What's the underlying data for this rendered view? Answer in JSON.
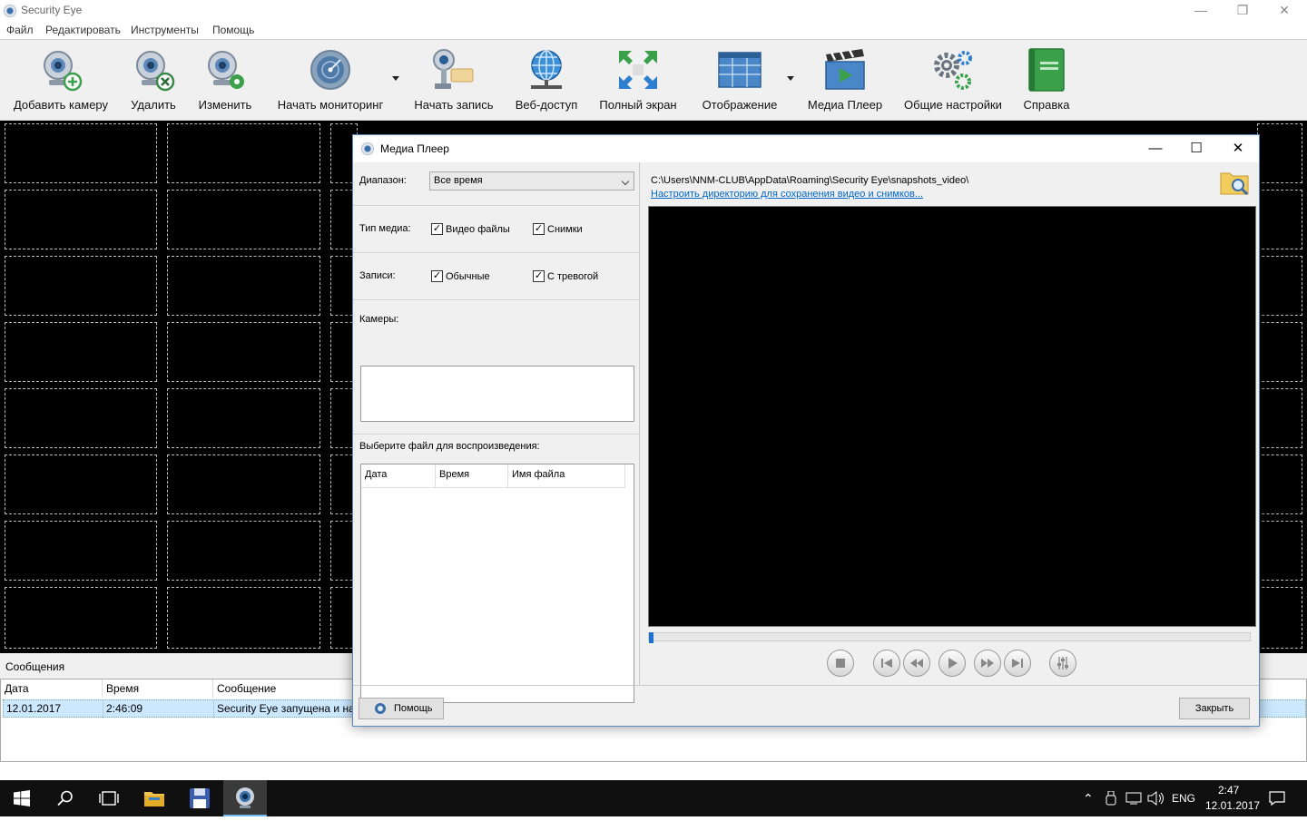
{
  "app": {
    "title": "Security Eye",
    "controls": {
      "minimize": "—",
      "restore": "❐",
      "close": "✕"
    }
  },
  "menu": [
    "Файл",
    "Редактировать",
    "Инструменты",
    "Помощь"
  ],
  "toolbar": {
    "items": [
      {
        "label": "Добавить камеру",
        "icon": "camera-add-icon"
      },
      {
        "label": "Удалить",
        "icon": "camera-remove-icon"
      },
      {
        "label": "Изменить",
        "icon": "camera-edit-icon"
      },
      {
        "label": "Начать мониторинг",
        "icon": "radar-icon"
      },
      {
        "label": "Начать запись",
        "icon": "record-camera-icon"
      },
      {
        "label": "Веб-доступ",
        "icon": "globe-icon"
      },
      {
        "label": "Полный экран",
        "icon": "fullscreen-icon"
      },
      {
        "label": "Отображение",
        "icon": "layout-icon"
      },
      {
        "label": "Медиа Плеер",
        "icon": "media-player-icon"
      },
      {
        "label": "Общие настройки",
        "icon": "gears-icon"
      },
      {
        "label": "Справка",
        "icon": "book-icon"
      }
    ]
  },
  "messages": {
    "header": "Сообщения",
    "columns": [
      "Дата",
      "Время",
      "Сообщение"
    ],
    "rows": [
      {
        "date": "12.01.2017",
        "time": "2:46:09",
        "message": "Security Eye запущена и настр"
      }
    ]
  },
  "dialog": {
    "title": "Медиа Плеер",
    "range_label": "Диапазон:",
    "range_value": "Все время",
    "media_type_label": "Тип медиа:",
    "video_files": "Видео файлы",
    "snapshots": "Снимки",
    "records_label": "Записи:",
    "normal": "Обычные",
    "alarm": "С тревогой",
    "cameras_label": "Камеры:",
    "choose_file_label": "Выберите файл для воспроизведения:",
    "file_columns": [
      "Дата",
      "Время",
      "Имя файла"
    ],
    "path": "C:\\Users\\NNM-CLUB\\AppData\\Roaming\\Security Eye\\snapshots_video\\",
    "path_link": "Настроить директорию для сохранения видео и снимков...",
    "help_button": "Помощь",
    "close_button": "Закрыть",
    "playback_position": 0
  },
  "taskbar": {
    "lang": "ENG",
    "time": "2:47",
    "date": "12.01.2017"
  }
}
